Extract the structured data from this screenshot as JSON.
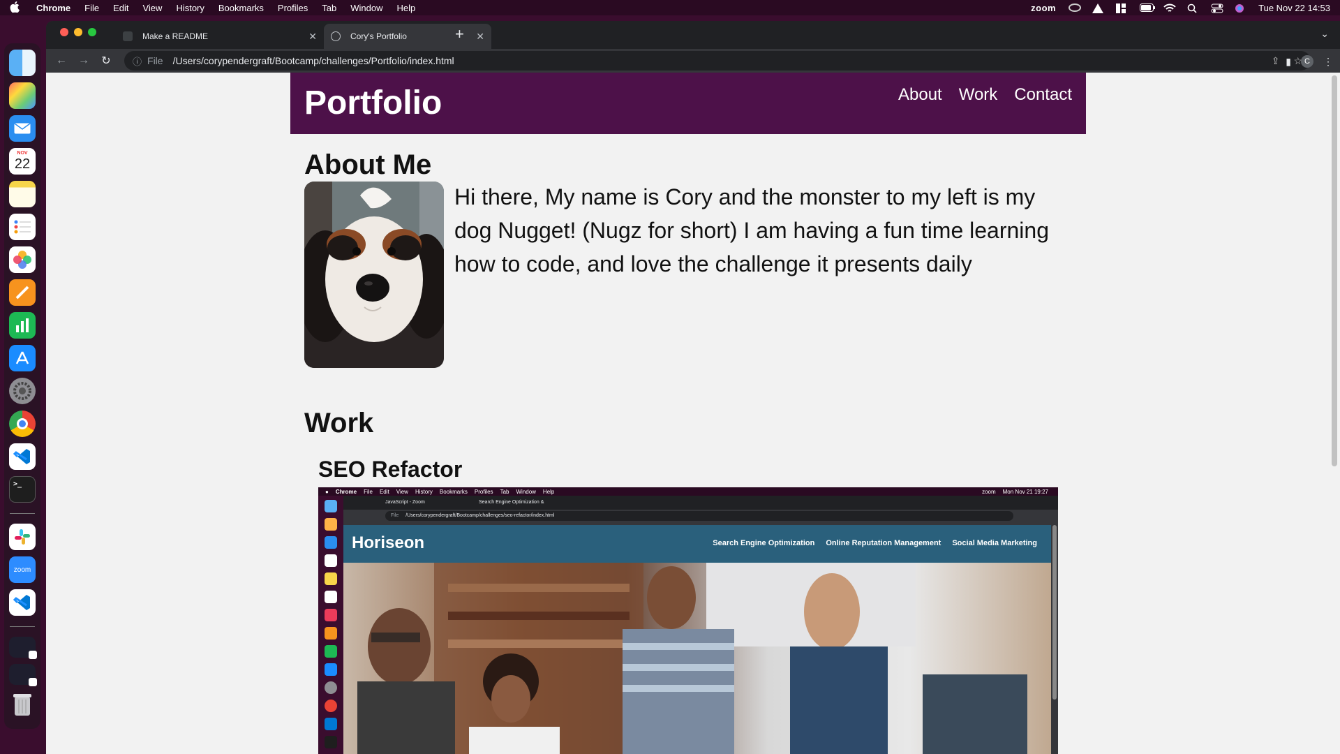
{
  "menubar": {
    "app": "Chrome",
    "items": [
      "File",
      "Edit",
      "View",
      "History",
      "Bookmarks",
      "Profiles",
      "Tab",
      "Window",
      "Help"
    ],
    "status_icons": [
      "zoom-icon",
      "creative-cloud-icon",
      "drive-icon",
      "grid-icon",
      "battery-icon",
      "wifi-icon",
      "search-icon",
      "control-center-icon",
      "siri-icon"
    ],
    "zoom_label": "zoom",
    "datetime": "Tue Nov 22  14:53"
  },
  "dock": {
    "calendar_month": "NOV",
    "calendar_day": "22",
    "zoom_label": "zoom"
  },
  "browser": {
    "tabs": [
      {
        "title": "Make a README",
        "active": false
      },
      {
        "title": "Cory's Portfolio",
        "active": true
      }
    ],
    "address": {
      "scheme_label": "File",
      "url": "/Users/corypendergraft/Bootcamp/challenges/Portfolio/index.html"
    },
    "profile_initial": "C"
  },
  "site": {
    "title": "Portfolio",
    "nav": [
      "About",
      "Work",
      "Contact"
    ],
    "about": {
      "heading": "About Me",
      "text": "Hi there, My name is Cory and the monster to my left is my dog Nugget! (Nugz for short) I am having a fun time learning how to code, and love the challenge it presents daily"
    },
    "work": {
      "heading": "Work",
      "project_title": "SEO Refactor",
      "screenshot": {
        "menubar_app": "Chrome",
        "menubar_items": [
          "File",
          "Edit",
          "View",
          "History",
          "Bookmarks",
          "Profiles",
          "Tab",
          "Window",
          "Help"
        ],
        "menubar_datetime": "Mon Nov 21  19:27",
        "menubar_zoom": "zoom",
        "tab1": "JavaScript - Zoom",
        "tab2": "Search Engine Optimization &",
        "url": "/Users/corypendergraft/Bootcamp/challenges/seo-refactor/index.html",
        "file_label": "File",
        "logo": "Horiseon",
        "nav": [
          "Search Engine Optimization",
          "Online Reputation Management",
          "Social Media Marketing"
        ]
      }
    }
  },
  "colors": {
    "header_bg": "#4d1149",
    "page_bg": "#f2f2f2",
    "horiseon_header": "#2a607c"
  }
}
